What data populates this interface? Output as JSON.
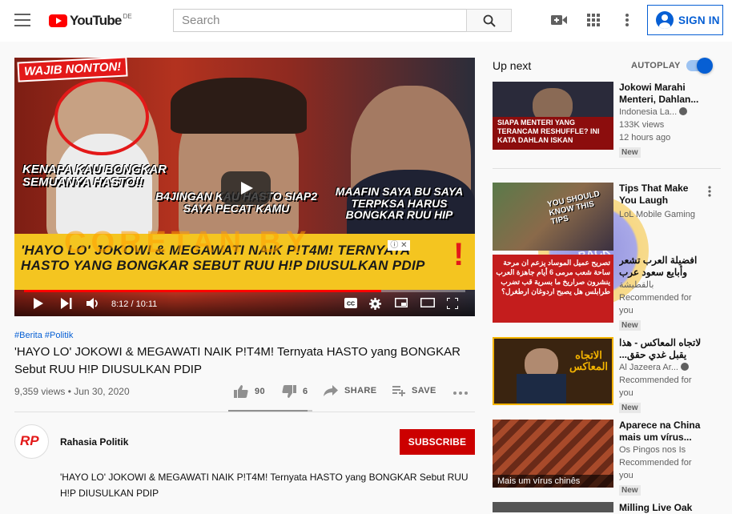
{
  "header": {
    "logo_text": "YouTube",
    "country": "DE",
    "search_placeholder": "Search",
    "signin_label": "SIGN IN"
  },
  "player": {
    "thumb_wajib": "WAJIB NONTON!",
    "thumb_text_1": "KENAPA KAU BONGKAR SEMUANYA HASTO!!",
    "thumb_text_2": "B4JINGAN KAU HASTO SIAP2 SAYA PECAT KAMU",
    "thumb_text_3": "MAAFIN SAYA BU SAYA TERPKSA HARUS BONGKAR RUU HIP",
    "thumb_banner": "'HAYO LO' JOKOWI & MEGAWATI NAIK P!T4M! TERNYATA HASTO YANG BONGKAR SEBUT RUU H!P DIUSULKAN PDIP",
    "time": "8:12 / 10:11",
    "progress": 0.81,
    "ad_close": "ⓘ ✕"
  },
  "watermark": {
    "text": "CORETAN BY",
    "seal_text": "TURN BACK HOAX"
  },
  "video": {
    "tags": "#Berita #Politik",
    "title": "'HAYO LO' JOKOWI & MEGAWATI NAIK P!T4M! Ternyata HASTO yang BONGKAR Sebut RUU H!P DIUSULKAN PDIP",
    "meta": "9,359 views • Jun 30, 2020",
    "likes": "90",
    "dislikes": "6",
    "share": "SHARE",
    "save": "SAVE",
    "like_ratio": 0.94
  },
  "channel": {
    "name": "Rahasia Politik",
    "avatar_text": "RP",
    "subscribe_label": "SUBSCRIBE",
    "description": "'HAYO LO' JOKOWI & MEGAWATI NAIK P!T4M! Ternyata HASTO yang BONGKAR Sebut RUU H!P DIUSULKAN PDIP"
  },
  "sidebar": {
    "upnext_label": "Up next",
    "autoplay_label": "AUTOPLAY",
    "autoplay_on": true,
    "items": [
      {
        "title": "Jokowi Marahi Menteri, Dahlan...",
        "channel": "Indonesia La...",
        "views": "133K views",
        "age": "12 hours ago",
        "badge": "New",
        "thumb_caption": "SIAPA MENTERI YANG TERANCAM RESHUFFLE? INI KATA DAHLAN ISKAN",
        "thumb_color": "#2a2a3a"
      },
      {
        "title": "Tips That Make You Laugh",
        "channel": "LoL Mobile Gaming",
        "thumb_caption": "YOU SHOULD KNOW THIS TIPS",
        "thumb_color": "#6b5a4a"
      },
      {
        "title": "افضيلة العرب تشعر وأبايع سعود عرب",
        "channel": "بالقطيشة",
        "views": "Recommended for you",
        "badge": "New",
        "thumb_caption": "تصريح عميل الموساد يزعم ان مرحة ساحة شعب مرمى 6 أيام جاهزة العرب ينشرون صراريخ ما بسرية قب تضرب طرابلس هل يصبح اردوغان ارطغرل؟",
        "thumb_color": "#c41d1d"
      },
      {
        "title": "لاتجاه المعاكس - هذا يقبل غدي حقق...",
        "channel": "Al Jazeera Ar...",
        "views": "Recommended for you",
        "badge": "New",
        "thumb_caption": "الاتجاه المعاكس",
        "thumb_color": "#3a2410"
      },
      {
        "title": "Aparece na China mais um vírus...",
        "channel": "Os Pingos nos Is",
        "views": "Recommended for you",
        "badge": "New",
        "thumb_caption": "Mais um vírus chinês",
        "thumb_color": "#8a3a22"
      },
      {
        "title": "Milling Live Oak",
        "thumb_caption": "",
        "thumb_color": "#555"
      }
    ]
  }
}
